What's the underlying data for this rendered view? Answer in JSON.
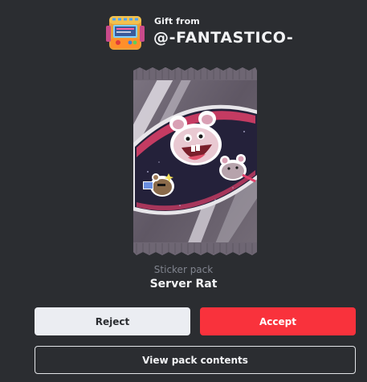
{
  "sender": {
    "label": "Gift from",
    "name": "@-FANTASTICO-"
  },
  "pack": {
    "type_label": "Sticker pack",
    "name": "Server Rat"
  },
  "actions": {
    "reject_label": "Reject",
    "accept_label": "Accept",
    "view_label": "View pack contents"
  },
  "colors": {
    "background": "#2b2d31",
    "accept": "#f9323c",
    "reject": "#ebedf2"
  }
}
